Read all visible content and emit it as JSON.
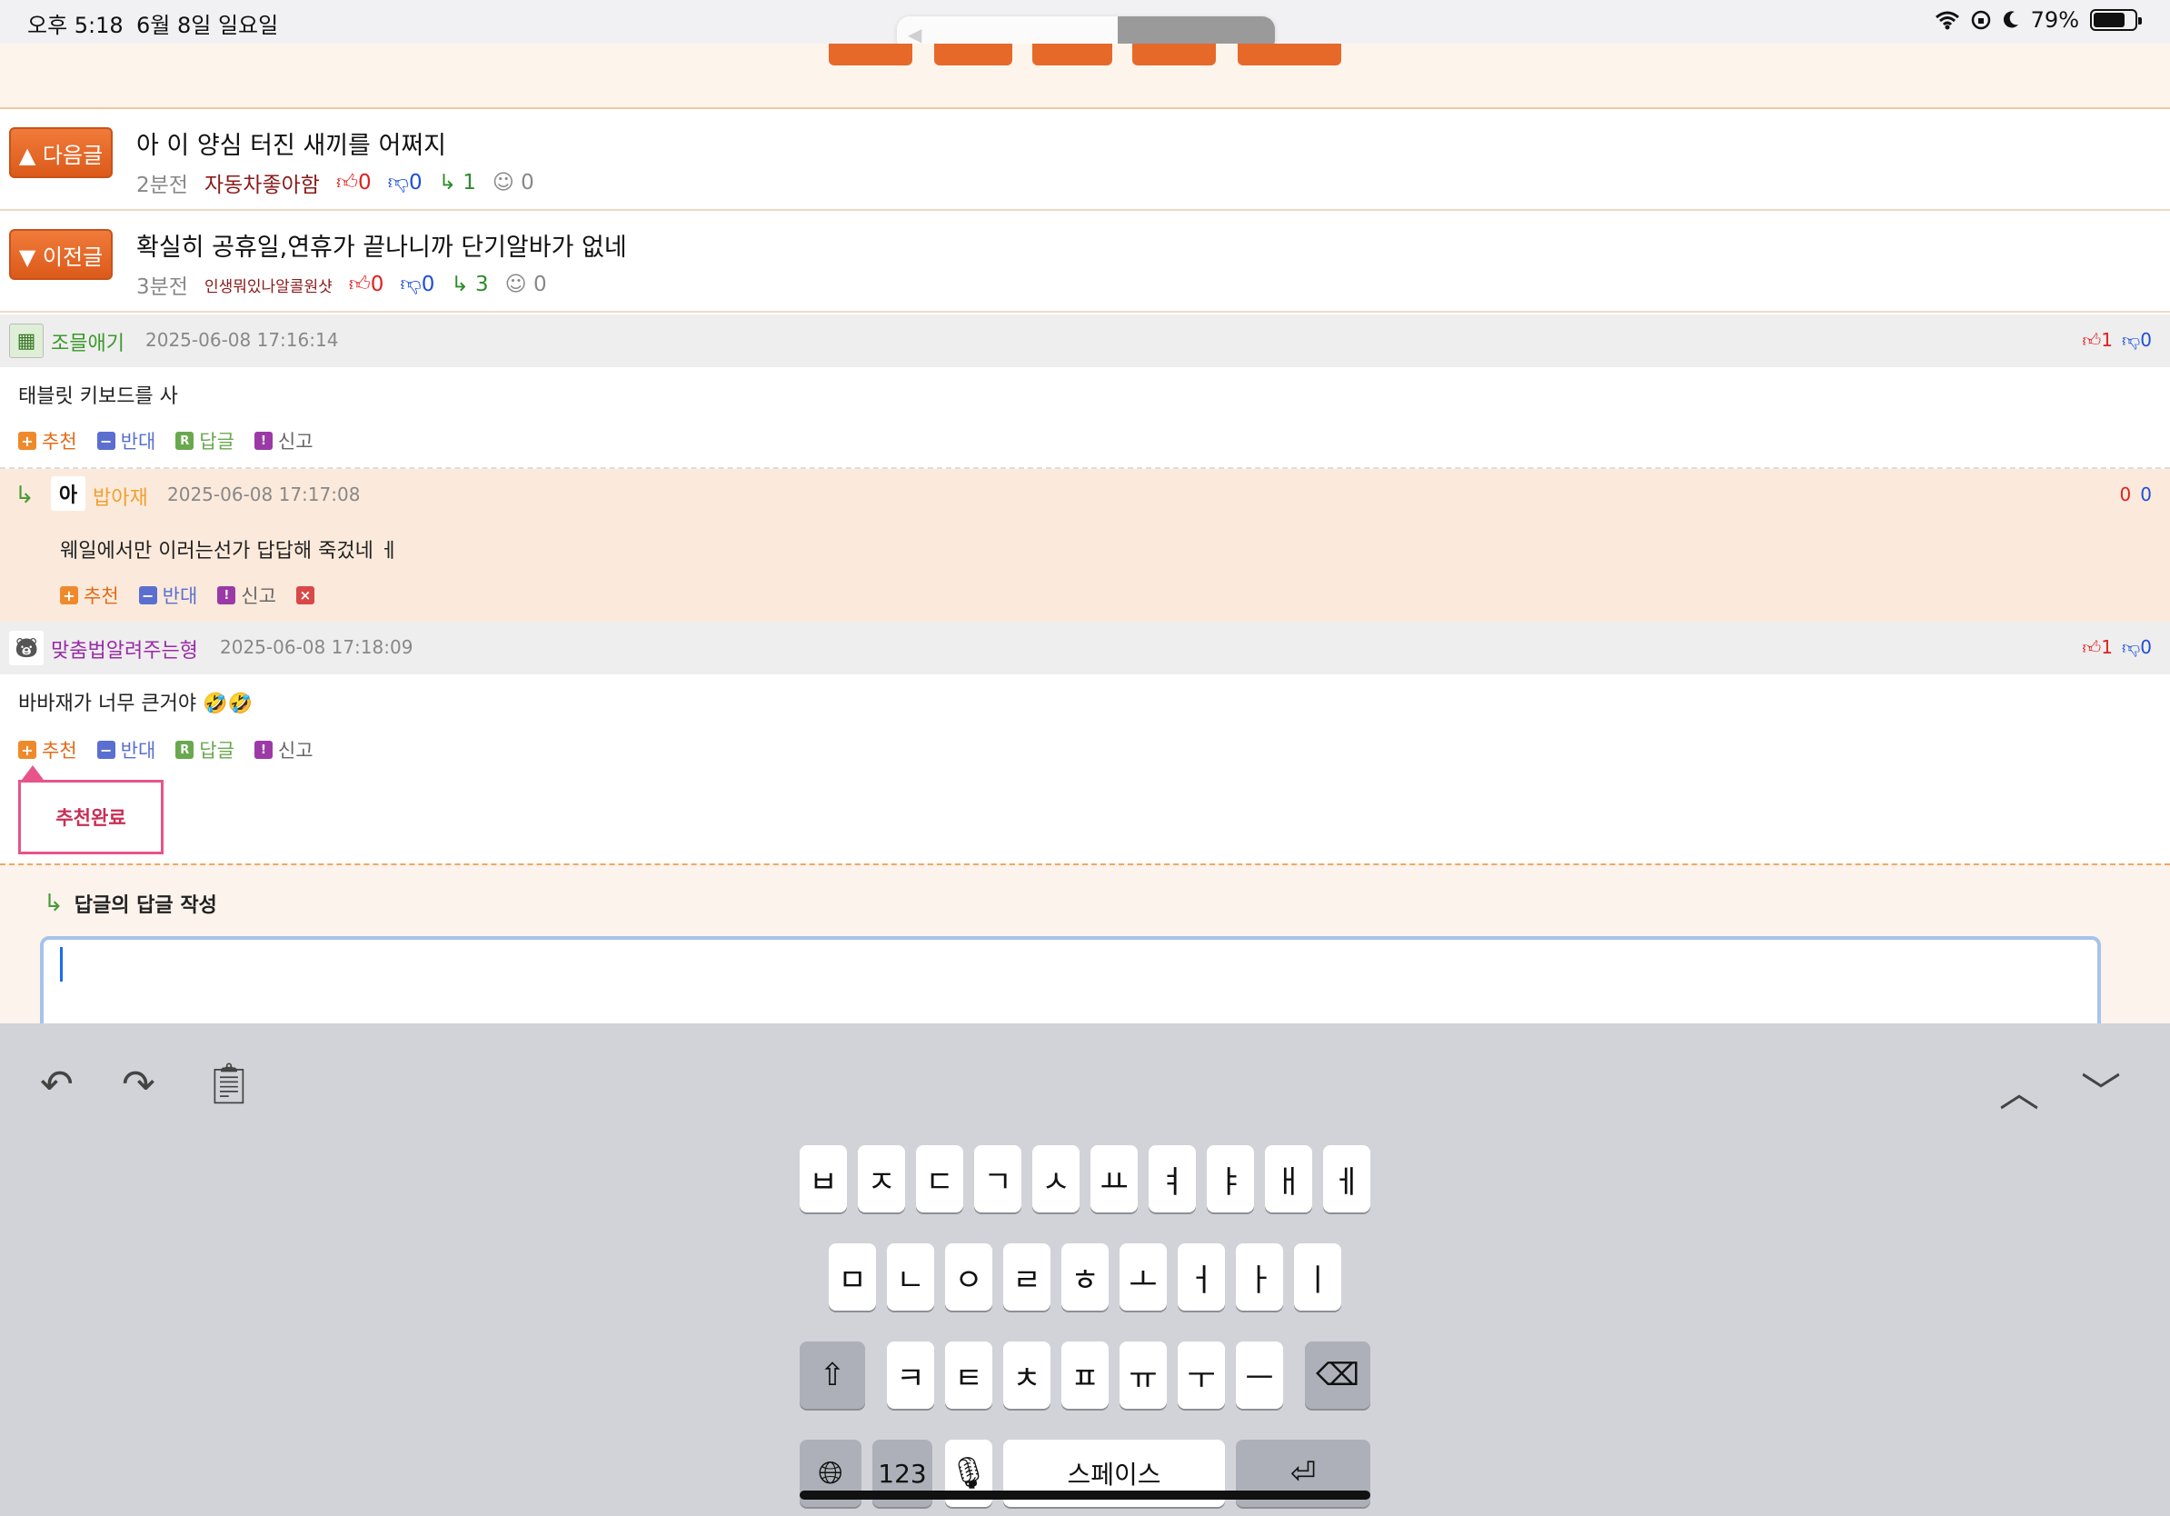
{
  "status": {
    "time": "오후 5:18",
    "date": "6월 8일 일요일",
    "battery": "79%",
    "battery_level": 0.79
  },
  "next_post": {
    "button": "▲ 다음글",
    "title": "아 이 양심 터진 새끼를 어쩌지",
    "time": "2분전",
    "author": "자동차좋아함",
    "up": "0",
    "down": "0",
    "replies": "1",
    "views": "0"
  },
  "prev_post": {
    "button": "▼ 이전글",
    "title": "확실히 공휴일,연휴가 끝나니까 단기알바가 없네",
    "time": "3분전",
    "author": "인생뭐있나알콜원샷",
    "up": "0",
    "down": "0",
    "replies": "3",
    "views": "0"
  },
  "comments": [
    {
      "author": "조믈애기",
      "date": "2025-06-08 17:16:14",
      "up": "1",
      "down": "0",
      "text": "태블릿 키보드를 사",
      "actions": {
        "recommend": "추천",
        "oppose": "반대",
        "reply": "답글",
        "report": "신고"
      }
    },
    {
      "avatar_text": "아",
      "author": "밥아재",
      "date": "2025-06-08 17:17:08",
      "up": "0",
      "down": "0",
      "text": "웨일에서만 이러는선가 답답해 죽겄네 ㅔ",
      "actions": {
        "recommend": "추천",
        "oppose": "반대",
        "report": "신고"
      }
    },
    {
      "author": "맞춤법알려주는형",
      "date": "2025-06-08 17:18:09",
      "up": "1",
      "down": "0",
      "text": "바바재가 너무 큰거야 🤣🤣",
      "actions": {
        "recommend": "추천",
        "oppose": "반대",
        "reply": "답글",
        "report": "신고"
      },
      "popup": "추천완료"
    }
  ],
  "write": {
    "title": "답글의 답글 작성"
  },
  "keyboard": {
    "row1": [
      "ㅂ",
      "ㅈ",
      "ㄷ",
      "ㄱ",
      "ㅅ",
      "ㅛ",
      "ㅕ",
      "ㅑ",
      "ㅐ",
      "ㅔ"
    ],
    "row2": [
      "ㅁ",
      "ㄴ",
      "ㅇ",
      "ㄹ",
      "ㅎ",
      "ㅗ",
      "ㅓ",
      "ㅏ",
      "ㅣ"
    ],
    "row3": [
      "ㅋ",
      "ㅌ",
      "ㅊ",
      "ㅍ",
      "ㅠ",
      "ㅜ",
      "ㅡ"
    ],
    "numbers": "123",
    "space": "스페이스"
  },
  "colors": {
    "accent_orange": "#e6692a",
    "up_red": "#e02020",
    "down_blue": "#1e4fd8",
    "popup_pink": "#e7548a"
  }
}
